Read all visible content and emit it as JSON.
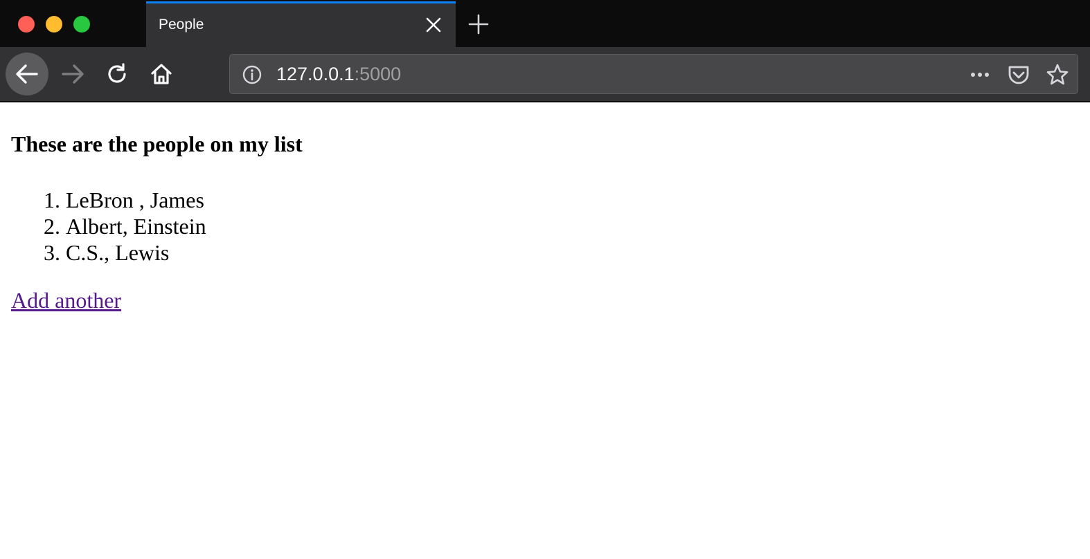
{
  "browser": {
    "tab": {
      "title": "People"
    },
    "address": {
      "host": "127.0.0.1",
      "port": ":5000"
    },
    "icons": {
      "back": "arrow-left",
      "forward": "arrow-right",
      "reload": "reload",
      "home": "home",
      "info": "info",
      "more": "ellipsis",
      "pocket": "pocket",
      "bookmark": "star",
      "close_tab": "close",
      "new_tab": "plus"
    }
  },
  "page": {
    "heading": "These are the people on my list",
    "people": [
      {
        "label": "LeBron , James"
      },
      {
        "label": "Albert, Einstein"
      },
      {
        "label": "C.S., Lewis"
      }
    ],
    "add_link": "Add another",
    "link_color": "#551a8b"
  }
}
